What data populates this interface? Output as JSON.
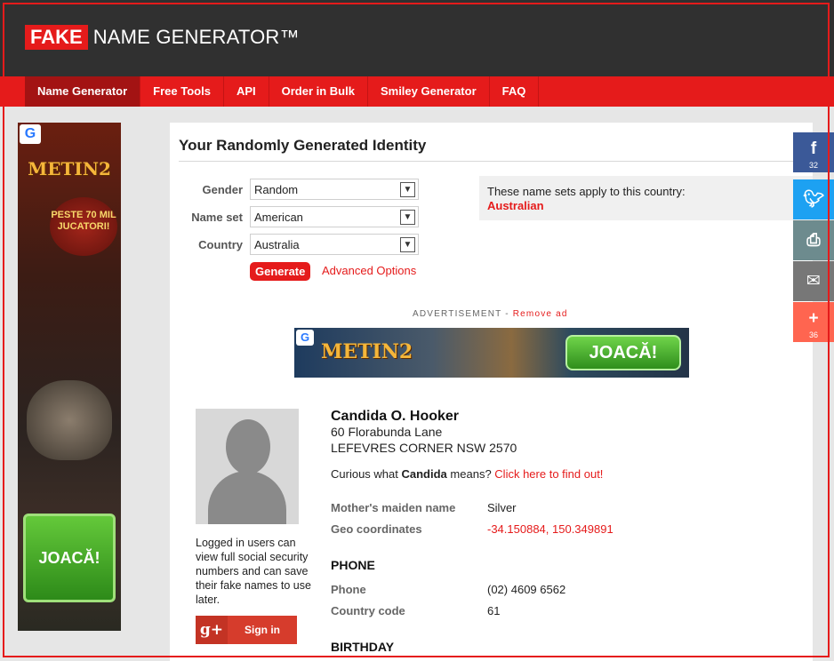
{
  "header": {
    "logo_fake": "FAKE",
    "logo_rest": "NAME GENERATOR™"
  },
  "nav": {
    "items": [
      "Name Generator",
      "Free Tools",
      "API",
      "Order in Bulk",
      "Smiley Generator",
      "FAQ"
    ],
    "active": "Name Generator"
  },
  "left_ad": {
    "brand": "METIN2",
    "badge": "PESTE 70 MIL JUCATORI!",
    "cta": "JOACĂ!"
  },
  "main": {
    "title": "Your Randomly Generated Identity",
    "form": {
      "gender_label": "Gender",
      "gender_value": "Random",
      "nameset_label": "Name set",
      "nameset_value": "American",
      "country_label": "Country",
      "country_value": "Australia",
      "generate_label": "Generate",
      "advanced_label": "Advanced Options"
    },
    "info": {
      "text": "These name sets apply to this country:",
      "country": "Australian"
    },
    "advertisement": {
      "label": "ADVERTISEMENT -",
      "remove": "Remove ad",
      "brand": "METIN2",
      "cta": "JOACĂ!"
    }
  },
  "identity": {
    "name": "Candida O. Hooker",
    "address_line1": "60 Florabunda Lane",
    "address_line2": "LEFEVRES CORNER NSW 2570",
    "curious_prefix": "Curious what",
    "curious_name": "Candida",
    "curious_mid": "means?",
    "curious_link": "Click here to find out!",
    "mothers_maiden_label": "Mother's maiden name",
    "mothers_maiden_value": "Silver",
    "geo_label": "Geo coordinates",
    "geo_value": "-34.150884, 150.349891",
    "phone_heading": "PHONE",
    "phone_label": "Phone",
    "phone_value": "(02) 4609 6562",
    "country_code_label": "Country code",
    "country_code_value": "61",
    "birthday_heading": "BIRTHDAY"
  },
  "login": {
    "text": "Logged in users can view full social security numbers and can save their fake names to use later.",
    "signin_label": "Sign in"
  },
  "share": {
    "facebook_count": "32",
    "more_count": "36"
  },
  "colors": {
    "accent": "#e51b1b",
    "header_bg": "#303030",
    "facebook": "#3b5998",
    "twitter": "#1da1f2",
    "print": "#6d8b8e",
    "email": "#777777",
    "more": "#ff6550"
  }
}
